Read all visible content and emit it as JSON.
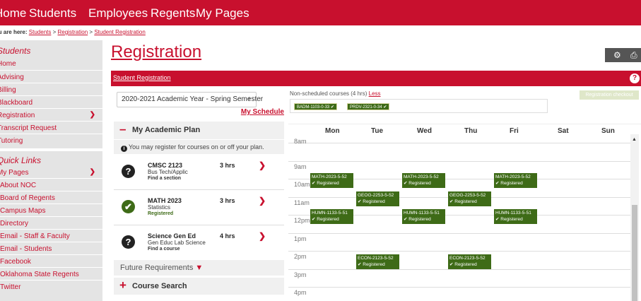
{
  "topnav": [
    "Home",
    "Students",
    "Employees",
    "Regents",
    "My Pages"
  ],
  "breadcrumb": {
    "label": "You are here:",
    "items": [
      "Students",
      "Registration",
      "Student Registration"
    ],
    "sep": ">"
  },
  "sidebar": {
    "section1": {
      "title": "Students",
      "items": [
        "Home",
        "Advising",
        "Billing",
        "Blackboard",
        "Registration",
        "Transcript Request",
        "Tutoring"
      ]
    },
    "section2": {
      "title": "Quick Links",
      "items": [
        "My Pages",
        "About NOC",
        "Board of Regents",
        "Campus Maps",
        "Directory",
        "Email - Staff & Faculty",
        "Email - Students",
        "Facebook",
        "Oklahoma State Regents",
        "Twitter"
      ]
    }
  },
  "page": {
    "title": "Registration",
    "bar_label": "Student Registration"
  },
  "term": {
    "selected": "2020-2021 Academic Year - Spring Semester",
    "my_schedule": "My Schedule"
  },
  "plan": {
    "title": "My Academic Plan",
    "info": "You may register for courses on or off your plan.",
    "courses": [
      {
        "code": "CMSC 2123",
        "name": "Bus Tech/Applic",
        "status": "Find a section",
        "hours": "3 hrs"
      },
      {
        "code": "MATH 2023",
        "name": "Statistics",
        "status": "Registered",
        "hours": "3 hrs"
      },
      {
        "code": "Science Gen Ed",
        "name": "Gen Educ Lab Science",
        "status": "Find a course",
        "hours": "4 hrs"
      }
    ],
    "future": "Future Requirements",
    "course_search": "Course Search"
  },
  "nonscheduled": {
    "label": "Non-scheduled courses (4 hrs)",
    "toggle": "Less",
    "chips": [
      "BADM-1103-0-33 ✔",
      "PRDV-2321-0-34 ✔"
    ]
  },
  "checkout": "Registration checkout",
  "calendar": {
    "days": [
      "Mon",
      "Tue",
      "Wed",
      "Thu",
      "Fri",
      "Sat",
      "Sun"
    ],
    "times": [
      "8am",
      "9am",
      "10am",
      "11am",
      "12pm",
      "1pm",
      "2pm",
      "3pm",
      "4pm"
    ],
    "status": "✔ Registered",
    "events": [
      {
        "course": "MATH-2023-5-52",
        "day": 0,
        "start": 9.5
      },
      {
        "course": "MATH-2023-5-52",
        "day": 2,
        "start": 9.5
      },
      {
        "course": "MATH-2023-5-52",
        "day": 4,
        "start": 9.5
      },
      {
        "course": "GEOG-2253-5-52",
        "day": 1,
        "start": 10.5
      },
      {
        "course": "GEOG-2253-5-52",
        "day": 3,
        "start": 10.5
      },
      {
        "course": "HUMN-1133-5-51",
        "day": 0,
        "start": 11.5
      },
      {
        "course": "HUMN-1133-5-51",
        "day": 2,
        "start": 11.5
      },
      {
        "course": "HUMN-1133-5-51",
        "day": 4,
        "start": 11.5
      },
      {
        "course": "ECON-2123-5-52",
        "day": 1,
        "start": 14.0
      },
      {
        "course": "ECON-2123-5-52",
        "day": 3,
        "start": 14.0
      }
    ]
  },
  "colors": {
    "brand": "#c8102e",
    "registered": "#3e6b17"
  }
}
